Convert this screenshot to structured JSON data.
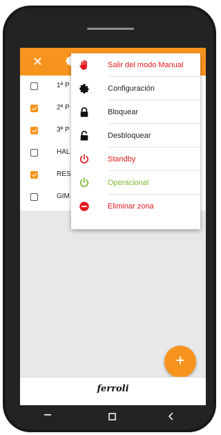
{
  "app": {
    "close_symbol": "✕",
    "close_icon": "close-icon",
    "settings_icon": "gear-icon"
  },
  "zones": [
    {
      "label": "1ª P",
      "checked": false
    },
    {
      "label": "2ª P",
      "checked": true
    },
    {
      "label": "3ª P",
      "checked": true
    },
    {
      "label": "HAL",
      "checked": false
    },
    {
      "label": "RES",
      "checked": true
    },
    {
      "label": "GIM",
      "checked": false
    }
  ],
  "menu": {
    "items": [
      {
        "label": "Salir del modo Manual",
        "icon": "hand-icon",
        "color": "#e2191e"
      },
      {
        "label": "Configuración",
        "icon": "gear-icon",
        "color": "#222222"
      },
      {
        "label": "Bloquear",
        "icon": "lock-icon",
        "color": "#222222"
      },
      {
        "label": "Desbloquear",
        "icon": "unlock-icon",
        "color": "#222222"
      },
      {
        "label": "Standby",
        "icon": "power-icon",
        "color": "#e2191e"
      },
      {
        "label": "Operacional",
        "icon": "power-icon",
        "color": "#7cb82f"
      },
      {
        "label": "Eliminar zona",
        "icon": "remove-icon",
        "color": "#e2191e"
      }
    ]
  },
  "fab": {
    "symbol": "+",
    "icon": "add-icon"
  },
  "footer": {
    "brand": "ferroli"
  },
  "colors": {
    "accent": "#f7941d",
    "danger": "#e2191e",
    "ok": "#7cb82f"
  }
}
